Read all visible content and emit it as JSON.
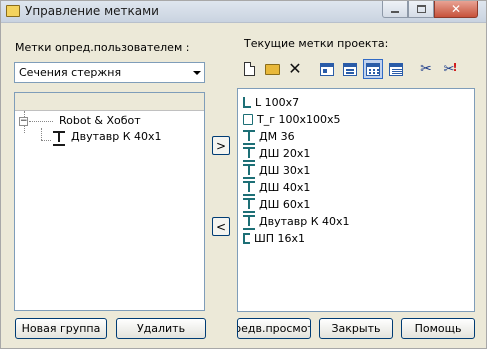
{
  "window": {
    "title": "Управление метками"
  },
  "left_panel": {
    "label": "Метки опред.пользователем :",
    "combo_value": "Сечения стержня",
    "tree": {
      "root_label": "Robot & Хобот",
      "root_toggle": "−",
      "child_label": "Двутавр К 40x1"
    }
  },
  "transfer": {
    "right_arrow": ">",
    "left_arrow": "<"
  },
  "right_panel": {
    "label": "Текущие метки проекта:",
    "toolbar": {
      "scissors": "✂",
      "scissors_delete_mark": "!"
    },
    "items": [
      {
        "label": "L 100x7",
        "icon": "angle-icon"
      },
      {
        "label": "T_г 100x100x5",
        "icon": "box-icon"
      },
      {
        "label": "ДМ 36",
        "icon": "ibeam-icon"
      },
      {
        "label": "ДШ 20x1",
        "icon": "ibeam-icon"
      },
      {
        "label": "ДШ 30x1",
        "icon": "ibeam-icon"
      },
      {
        "label": "ДШ 40x1",
        "icon": "ibeam-icon"
      },
      {
        "label": "ДШ 60x1",
        "icon": "ibeam-icon"
      },
      {
        "label": "Двутавр К 40x1",
        "icon": "ibeam-icon"
      },
      {
        "label": "ШП 16x1",
        "icon": "channel-icon"
      }
    ]
  },
  "buttons": {
    "new_group": "Новая группа",
    "delete": "Удалить",
    "preview": "редв.просмот",
    "close": "Закрыть",
    "help": "Помощь"
  },
  "colors": {
    "dialog_bg": "#ece9d8",
    "accent_border": "#003c74",
    "section_icon": "#1d6f76"
  }
}
